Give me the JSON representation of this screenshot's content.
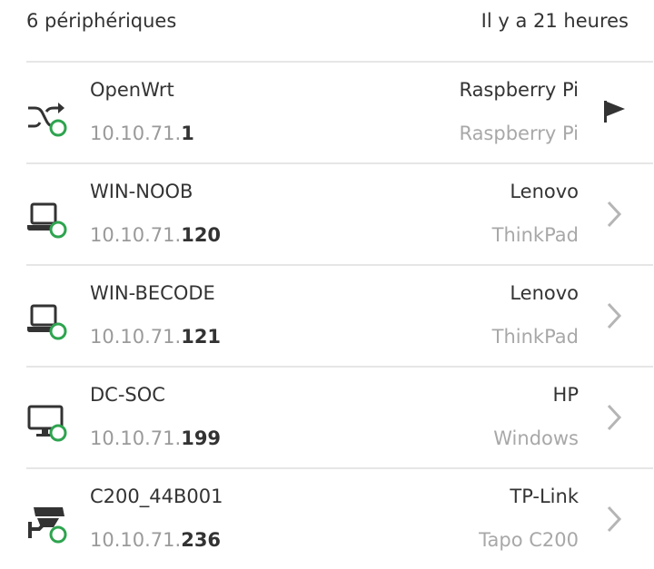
{
  "header": {
    "device_count": "6 périphériques",
    "last_seen": "Il y a 21 heures"
  },
  "colors": {
    "status_online": "#2ea44f",
    "icon": "#333333",
    "muted_text": "#9a9a9a",
    "divider": "#e6e6e6"
  },
  "devices": [
    {
      "icon": "router-shuffle-icon",
      "name": "OpenWrt",
      "ip_prefix": "10.10.71.",
      "ip_suffix": "1",
      "vendor": "Raspberry Pi",
      "model": "Raspberry Pi",
      "action": "flag-icon"
    },
    {
      "icon": "laptop-icon",
      "name": "WIN-NOOB",
      "ip_prefix": "10.10.71.",
      "ip_suffix": "120",
      "vendor": "Lenovo",
      "model": "ThinkPad",
      "action": "chevron-right-icon"
    },
    {
      "icon": "laptop-icon",
      "name": "WIN-BECODE",
      "ip_prefix": "10.10.71.",
      "ip_suffix": "121",
      "vendor": "Lenovo",
      "model": "ThinkPad",
      "action": "chevron-right-icon"
    },
    {
      "icon": "desktop-monitor-icon",
      "name": "DC-SOC",
      "ip_prefix": "10.10.71.",
      "ip_suffix": "199",
      "vendor": "HP",
      "model": "Windows",
      "action": "chevron-right-icon"
    },
    {
      "icon": "security-camera-icon",
      "name": "C200_44B001",
      "ip_prefix": "10.10.71.",
      "ip_suffix": "236",
      "vendor": "TP-Link",
      "model": "Tapo C200",
      "action": "chevron-right-icon"
    }
  ]
}
